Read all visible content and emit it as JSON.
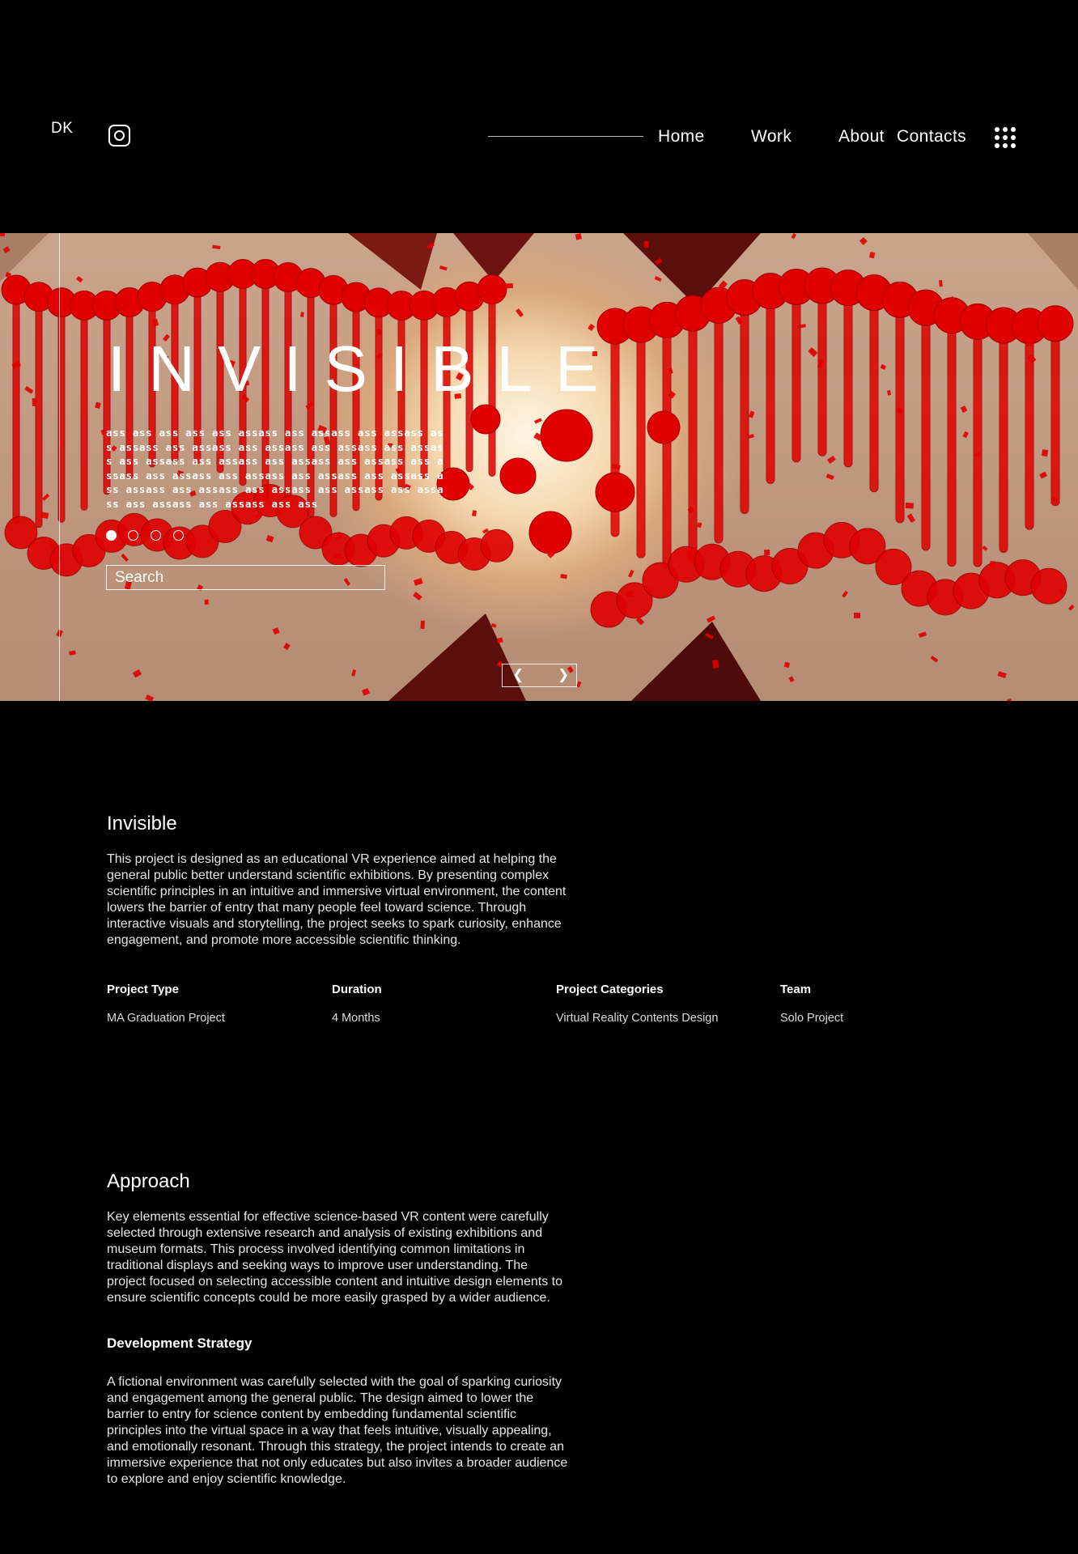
{
  "header": {
    "logo": "DK",
    "nav": [
      "Home",
      "Work",
      "About",
      "Contacts"
    ],
    "icons": [
      "instagram-icon",
      "menu-grid-icon"
    ]
  },
  "hero": {
    "title": "INVISIBLE",
    "body_text": "ass ass ass ass ass assass ass assass ass assass ass assass ass assass ass assass ass assass ass assass ass assass ass assass ass assass ass assass ass assass ass assass ass assass ass assass ass assass ass assass ass assass ass assass ass assass ass assass ass assass ass assass ass ass",
    "slide_count": 4,
    "active_slide": 1,
    "search_placeholder": "Search",
    "prev_icon": "chevron-left-icon",
    "next_icon": "chevron-right-icon"
  },
  "intro": {
    "title": "Invisible",
    "text": " This project is designed as an educational VR experience aimed at helping the\ngeneral public better understand scientific exhibitions. By presenting complex\nscientific principles in an intuitive and immersive virtual environment, the content\nlowers the barrier of entry that many people feel toward science. Through\ninteractive visuals and storytelling, the project seeks to spark curiosity, enhance\nengagement, and promote more accessible scientific thinking."
  },
  "meta": [
    {
      "label": "Project Type",
      "value": "MA Graduation Project"
    },
    {
      "label": "Duration",
      "value": "4 Months"
    },
    {
      "label": "Project Categories",
      "value": "Virtual Reality Contents Design"
    },
    {
      "label": "Team",
      "value": "Solo Project"
    }
  ],
  "approach": {
    "title": "Approach",
    "text": " Key elements essential for effective science-based VR content were carefully\nselected through extensive research and analysis of existing exhibitions and\nmuseum formats. This process involved identifying common limitations in\ntraditional displays and seeking ways to improve user understanding. The\nproject focused on selecting accessible content and intuitive design elements to\nensure scientific concepts could be more easily grasped by a wider audience."
  },
  "strategy": {
    "title": "Development Strategy",
    "text": "A fictional environment was carefully selected with the goal of sparking curiosity\nand engagement among the general public. The design aimed to lower the\nbarrier to entry for science content by embedding fundamental scientific\nprinciples into the virtual space in a way that feels intuitive, visually appealing,\nand emotionally resonant. Through this strategy, the project intends to create an\nimmersive experience that not only educates but also invites a broader audience\nto explore and enjoy scientific knowledge."
  },
  "colors": {
    "background": "#000000",
    "text": "#ffffff",
    "accent_red": "#e00000"
  }
}
